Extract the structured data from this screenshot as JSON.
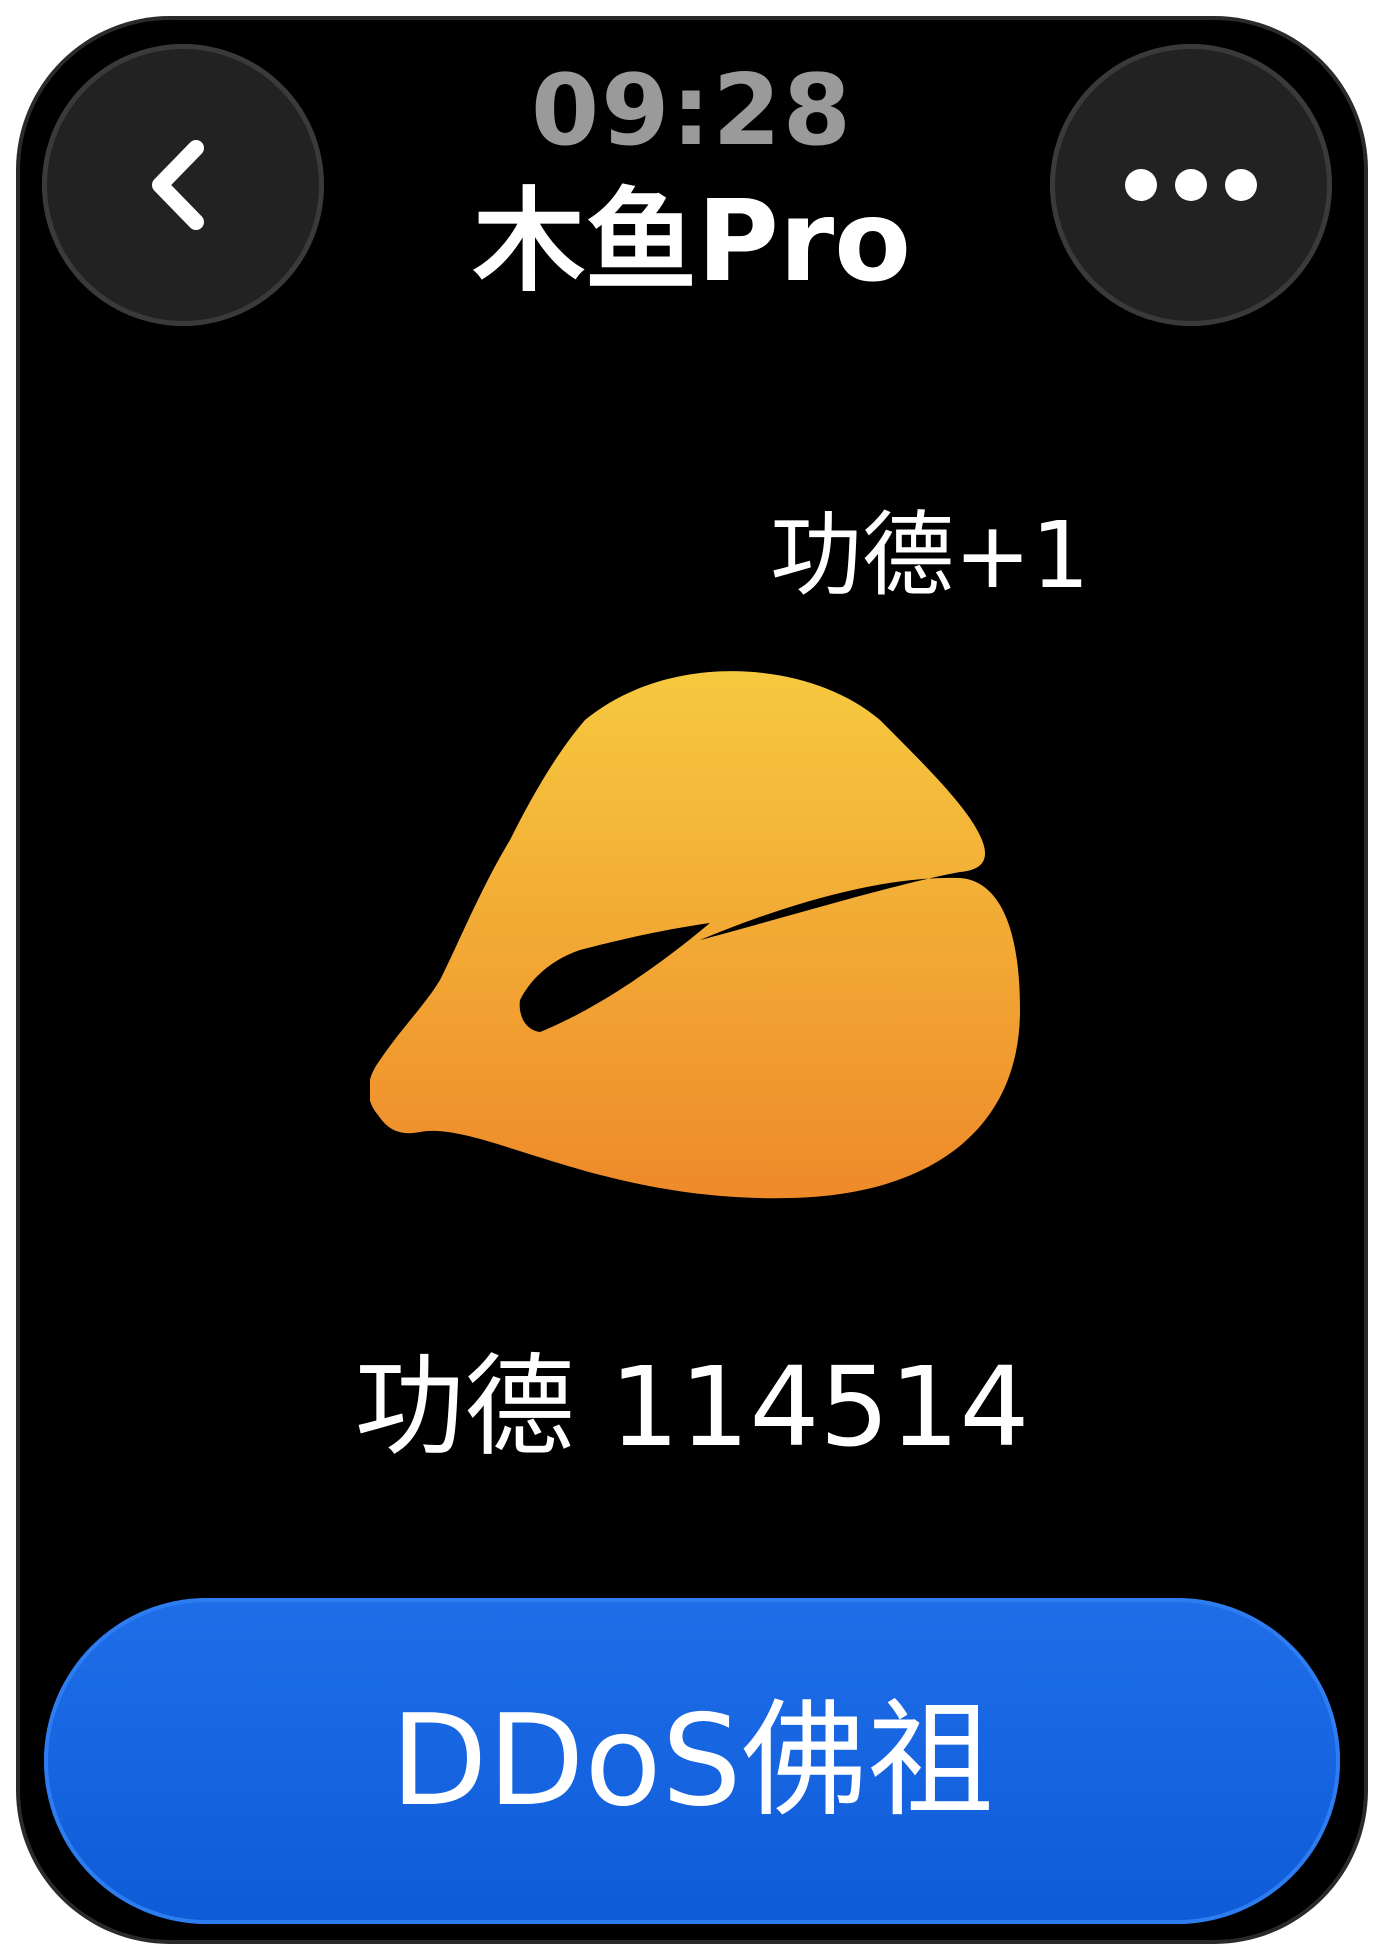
{
  "status": {
    "time": "09:28"
  },
  "header": {
    "title": "木鱼Pro",
    "back_icon": "chevron-left-icon",
    "more_icon": "ellipsis-icon"
  },
  "main": {
    "merit_increment": "功德+1",
    "merit_total": "功德 114514",
    "fish_icon": "wooden-fish-icon",
    "fish_colors": [
      "#f6c93f",
      "#ee8a2a"
    ]
  },
  "action": {
    "button_label": "DDoS佛祖",
    "button_color": "#1565e0"
  }
}
